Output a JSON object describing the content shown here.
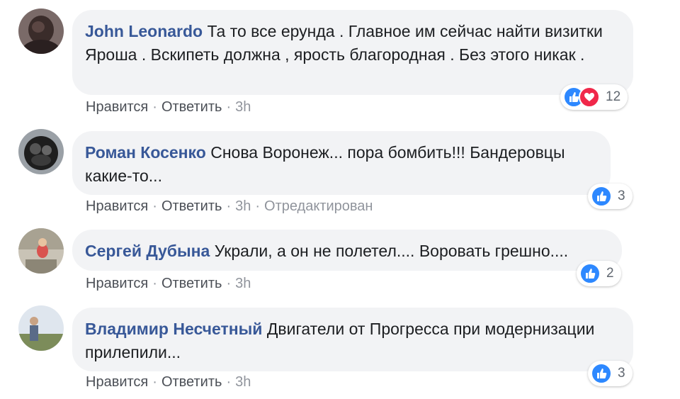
{
  "comments": [
    {
      "author": "John Leonardo",
      "text": "Та то все ерунда . Главное им сейчас найти визитки Яроша . Вскипеть должна , ярость благородная . Без этого никак .",
      "like": "Нравится",
      "reply": "Ответить",
      "time": "3h",
      "edited": "",
      "reaction_count": "12",
      "reactions": [
        "like-icon",
        "love-icon"
      ]
    },
    {
      "author": "Роман Косенко",
      "text": "Снова Воронеж... пора бомбить!!! Бандеровцы какие-то...",
      "like": "Нравится",
      "reply": "Ответить",
      "time": "3h",
      "edited": "Отредактирован",
      "reaction_count": "3",
      "reactions": [
        "like-icon"
      ]
    },
    {
      "author": "Сергей Дубына",
      "text": "Украли, а он не полетел.... Воровать грешно....",
      "like": "Нравится",
      "reply": "Ответить",
      "time": "3h",
      "edited": "",
      "reaction_count": "2",
      "reactions": [
        "like-icon"
      ]
    },
    {
      "author": "Владимир Несчетный",
      "text": "Двигатели от Прогресса при модернизации прилепили...",
      "like": "Нравится",
      "reply": "Ответить",
      "time": "3h",
      "edited": "",
      "reaction_count": "3",
      "reactions": [
        "like-icon"
      ]
    }
  ],
  "colors": {
    "author": "#385898",
    "bubble": "#f2f3f5",
    "like": "#2d88ff",
    "love": "#f0284a"
  }
}
